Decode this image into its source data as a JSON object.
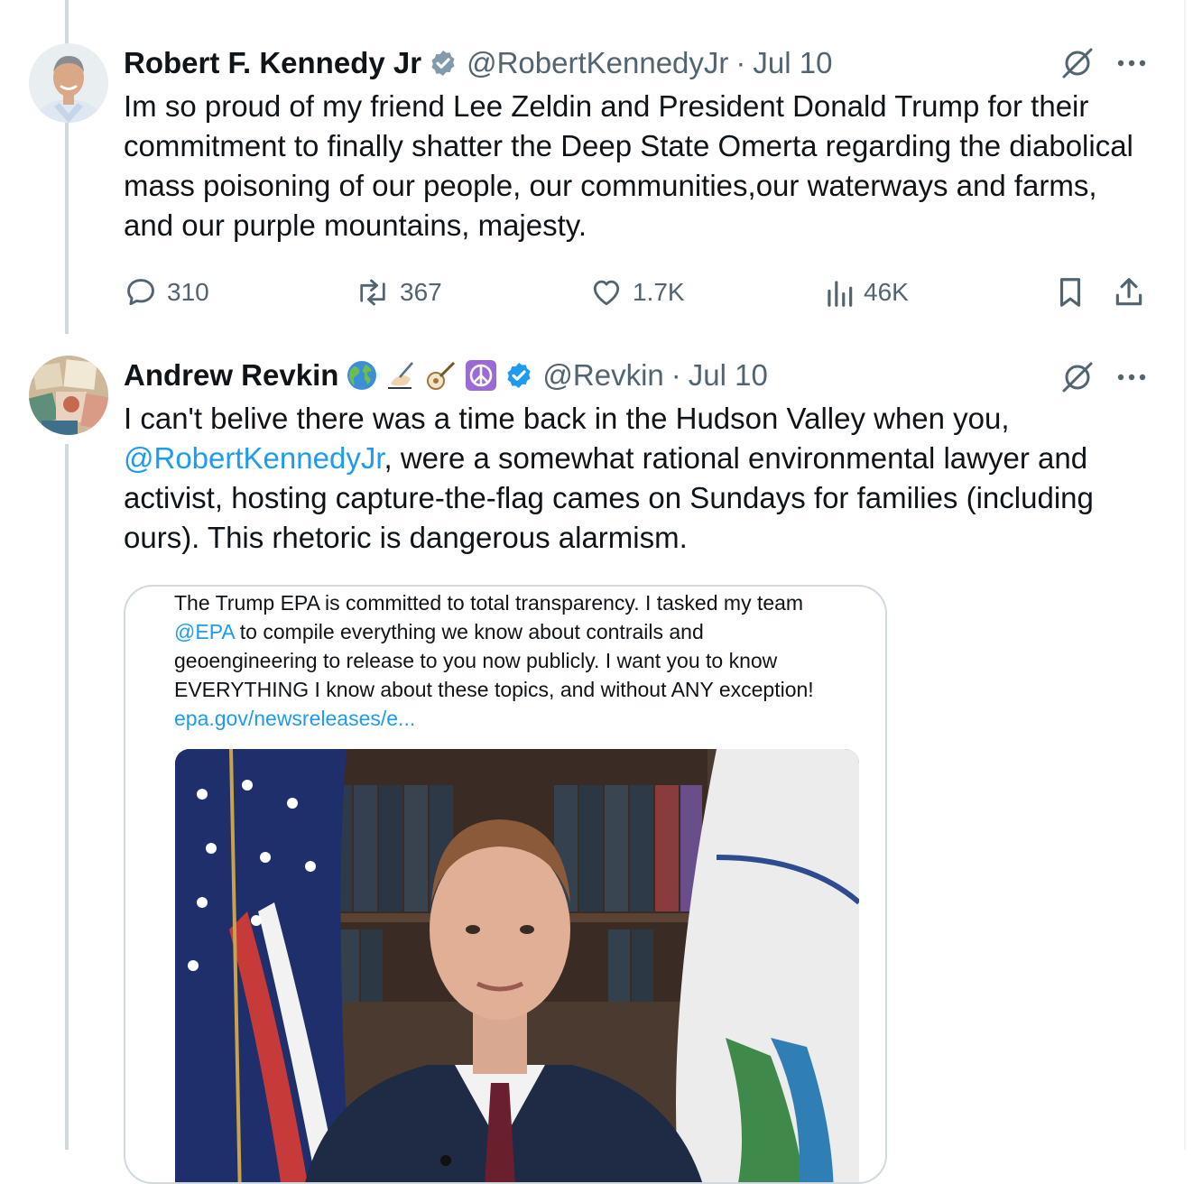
{
  "tweets": [
    {
      "display_name": "Robert F. Kennedy Jr",
      "handle": "@RobertKennedyJr",
      "separator": "·",
      "date": "Jul 10",
      "verified_icon": "verified-badge-icon",
      "text": "Im so proud of my friend Lee Zeldin and President Donald Trump for their commitment to finally shatter the Deep State Omerta regarding the diabolical mass poisoning of our people, our communities,our waterways and farms, and our purple mountains, majesty.",
      "actions": {
        "replies": "310",
        "reposts": "367",
        "likes": "1.7K",
        "views": "46K"
      }
    },
    {
      "display_name": "Andrew Revkin",
      "name_emojis": [
        "globe-icon",
        "writing-hand-icon",
        "banjo-icon",
        "peace-symbol-icon"
      ],
      "handle": "@Revkin",
      "separator": "·",
      "date": "Jul 10",
      "verified_icon": "verified-badge-icon",
      "text_before_mention": "I can't belive there was a time back in the Hudson Valley when you, ",
      "mention": "@RobertKennedyJr",
      "text_after_mention": ", were a somewhat rational environmental lawyer and activist, hosting capture-the-flag cames on Sundays for families (including ours). This rhetoric is dangerous alarmism.",
      "quote": {
        "text_before_mention": "The Trump EPA is committed to total transparency. I tasked my team ",
        "mention": "@EPA",
        "text_after_mention": " to compile everything we know about contrails and geoengineering to release to you now publicly. I want you to know EVERYTHING I know about these topics, and without ANY exception!",
        "link": "epa.gov/newsreleases/e...",
        "media": "video-thumbnail-man-at-podium-with-flags"
      }
    }
  ],
  "colors": {
    "text": "#0f1419",
    "secondary": "#536471",
    "accent": "#1d9bf0",
    "border": "#cfd9de"
  }
}
